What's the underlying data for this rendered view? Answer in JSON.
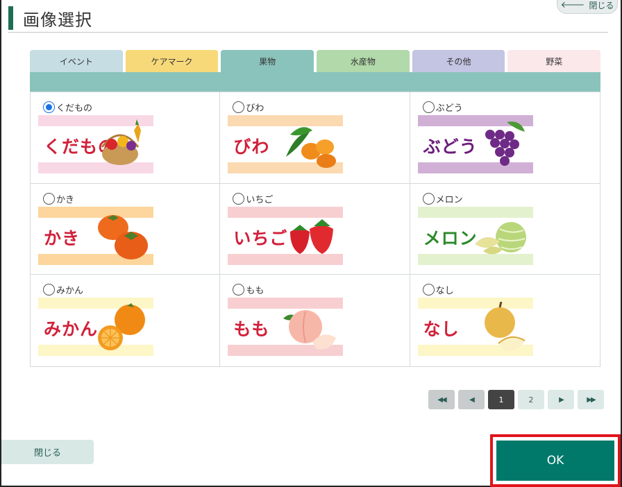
{
  "dialog": {
    "title": "画像選択",
    "top_close_label": "閉じる"
  },
  "tabs": [
    {
      "label": "イベント",
      "color": "#c5dde3"
    },
    {
      "label": "ケアマーク",
      "color": "#f7d97a"
    },
    {
      "label": "果物",
      "color": "#8ac3bc"
    },
    {
      "label": "水産物",
      "color": "#b2d9a9"
    },
    {
      "label": "その他",
      "color": "#c4c4e3"
    },
    {
      "label": "野菜",
      "color": "#fbe8ea"
    }
  ],
  "active_tab": "果物",
  "options": [
    {
      "label": "くだもの",
      "image_text": "くだもの",
      "selected": true,
      "stripe": "#f9d8e6",
      "text_color": "#d1203a",
      "art": "basket"
    },
    {
      "label": "びわ",
      "image_text": "びわ",
      "selected": false,
      "stripe": "#fbd9b1",
      "text_color": "#d1203a",
      "art": "loquat"
    },
    {
      "label": "ぶどう",
      "image_text": "ぶどう",
      "selected": false,
      "stripe": "#d1b0d6",
      "text_color": "#6d1b7b",
      "art": "grape"
    },
    {
      "label": "かき",
      "image_text": "かき",
      "selected": false,
      "stripe": "#fcd69c",
      "text_color": "#d1203a",
      "art": "persimmon"
    },
    {
      "label": "いちご",
      "image_text": "いちご",
      "selected": false,
      "stripe": "#f7cfd1",
      "text_color": "#d1203a",
      "art": "strawberry"
    },
    {
      "label": "メロン",
      "image_text": "メロン",
      "selected": false,
      "stripe": "#e3f1cf",
      "text_color": "#2a8a2a",
      "art": "melon"
    },
    {
      "label": "みかん",
      "image_text": "みかん",
      "selected": false,
      "stripe": "#fdf6c6",
      "text_color": "#d1203a",
      "art": "mikan"
    },
    {
      "label": "もも",
      "image_text": "もも",
      "selected": false,
      "stripe": "#f7cfd1",
      "text_color": "#d1203a",
      "art": "peach"
    },
    {
      "label": "なし",
      "image_text": "なし",
      "selected": false,
      "stripe": "#fdf6c6",
      "text_color": "#d1203a",
      "art": "pear"
    }
  ],
  "pager": {
    "first_icon": "double-left-icon",
    "prev_icon": "left-icon",
    "pages": [
      "1",
      "2"
    ],
    "current": "1",
    "next_icon": "right-icon",
    "last_icon": "double-right-icon"
  },
  "footer": {
    "close_label": "閉じる",
    "ok_label": "OK"
  }
}
